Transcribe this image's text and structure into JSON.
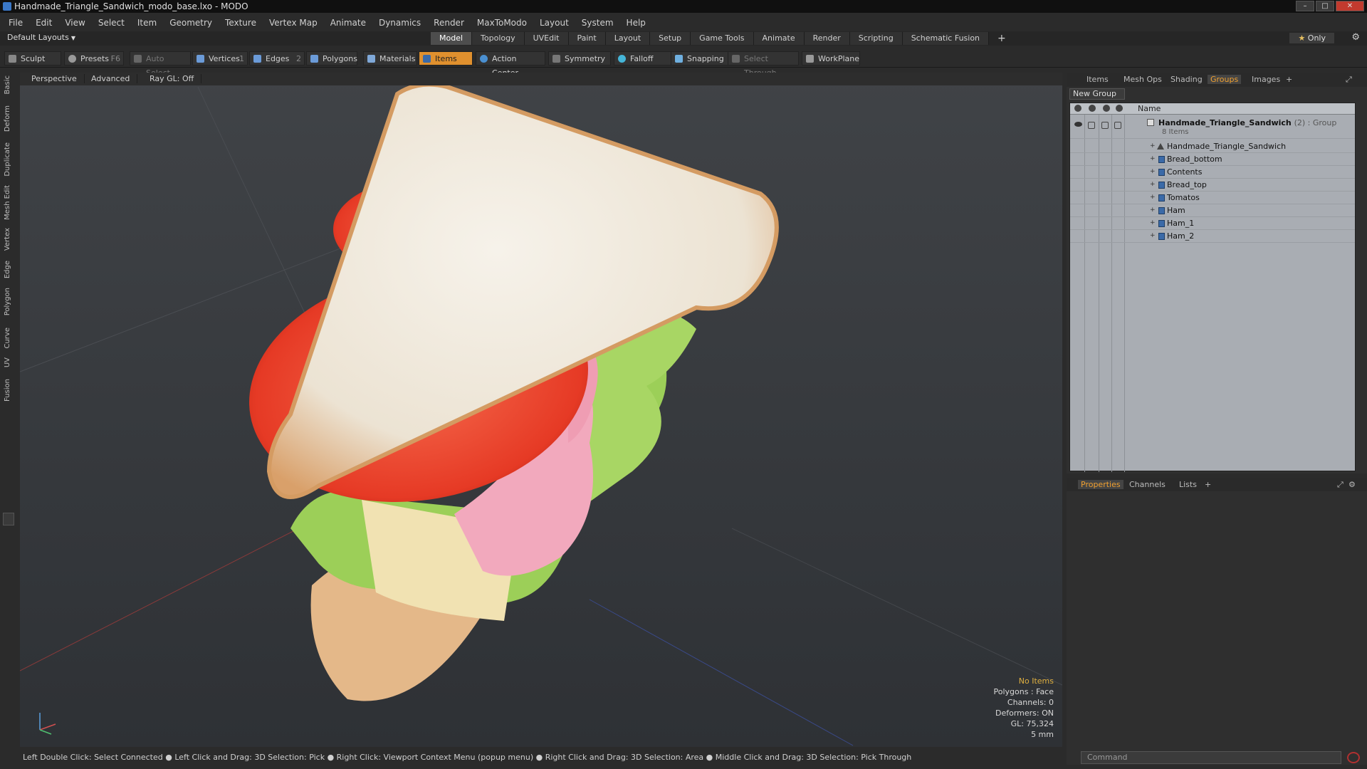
{
  "window": {
    "title": "Handmade_Triangle_Sandwich_modo_base.lxo - MODO"
  },
  "menu": [
    "File",
    "Edit",
    "View",
    "Select",
    "Item",
    "Geometry",
    "Texture",
    "Vertex Map",
    "Animate",
    "Dynamics",
    "Render",
    "MaxToModo",
    "Layout",
    "System",
    "Help"
  ],
  "layouts": {
    "selector": "Default Layouts",
    "tabs": [
      "Model",
      "Topology",
      "UVEdit",
      "Paint",
      "Layout",
      "Setup",
      "Game Tools",
      "Animate",
      "Render",
      "Scripting",
      "Schematic Fusion"
    ],
    "active": "Model",
    "only_label": "Only"
  },
  "toolbar": {
    "sculpt": "Sculpt",
    "presets": "Presets",
    "presets_key": "F6",
    "auto_select": "Auto Select",
    "vertices": "Vertices",
    "vertices_count": "1",
    "edges": "Edges",
    "edges_count": "2",
    "polygons": "Polygons",
    "materials": "Materials",
    "items": "Items",
    "action_center": "Action Center",
    "symmetry": "Symmetry",
    "falloff": "Falloff",
    "snapping": "Snapping",
    "select_through": "Select Through",
    "workplane": "WorkPlane"
  },
  "left_tabs": [
    "Basic",
    "Deform",
    "Duplicate",
    "Mesh Edit",
    "Vertex",
    "Edge",
    "Polygon",
    "Curve",
    "UV",
    "Fusion"
  ],
  "viewport": {
    "view": "Perspective",
    "shading": "Advanced",
    "raygl": "Ray GL: Off",
    "info": {
      "selection": "No Items",
      "polygons": "Polygons : Face",
      "channels": "Channels: 0",
      "deformers": "Deformers: ON",
      "gl": "GL: 75,324",
      "scale": "5 mm"
    }
  },
  "status_bar": "Left Double Click: Select Connected ● Left Click and Drag: 3D Selection: Pick ● Right Click: Viewport Context Menu (popup menu) ● Right Click and Drag: 3D Selection: Area ● Middle Click and Drag: 3D Selection: Pick Through",
  "scene_panel": {
    "tabs": [
      "Items",
      "Mesh Ops",
      "Shading",
      "Groups",
      "Images"
    ],
    "active_tab": "Groups",
    "new_group": "New Group",
    "column_name": "Name",
    "group": {
      "name": "Handmade_Triangle_Sandwich",
      "meta": "(2) : Group",
      "count": "8 Items"
    },
    "items": [
      {
        "label": "Handmade_Triangle_Sandwich",
        "kind": "locator"
      },
      {
        "label": "Bread_bottom",
        "kind": "mesh"
      },
      {
        "label": "Contents",
        "kind": "mesh"
      },
      {
        "label": "Bread_top",
        "kind": "mesh"
      },
      {
        "label": "Tomatos",
        "kind": "mesh"
      },
      {
        "label": "Ham",
        "kind": "mesh"
      },
      {
        "label": "Ham_1",
        "kind": "mesh"
      },
      {
        "label": "Ham_2",
        "kind": "mesh"
      }
    ]
  },
  "properties_panel": {
    "tabs": [
      "Properties",
      "Channels",
      "Lists"
    ],
    "active_tab": "Properties",
    "command_placeholder": "Command"
  },
  "colors": {
    "accent": "#f0a030",
    "active_tool": "#e0902e",
    "tree_bg": "#a9adb3"
  }
}
